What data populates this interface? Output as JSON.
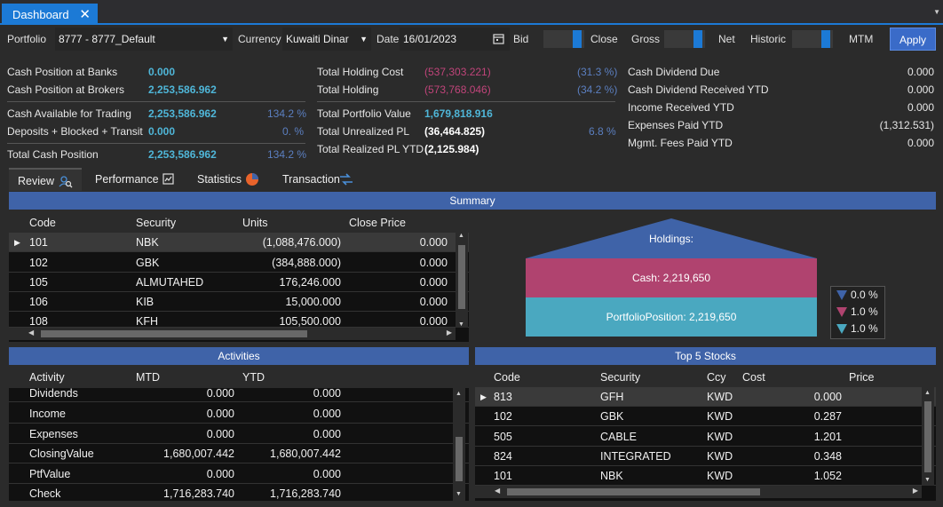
{
  "tab": {
    "title": "Dashboard",
    "close": "✕"
  },
  "toolbar": {
    "portfolio_label": "Portfolio",
    "portfolio_value": "8777 - 8777_Default",
    "currency_label": "Currency",
    "currency_value": "Kuwaiti Dinar",
    "date_label": "Date",
    "date_value": "16/01/2023",
    "bid": "Bid",
    "close": "Close",
    "gross": "Gross",
    "net": "Net",
    "historic": "Historic",
    "mtm": "MTM",
    "apply": "Apply"
  },
  "stats": {
    "cash_banks_label": "Cash Position at Banks",
    "cash_banks": "0.000",
    "cash_brokers_label": "Cash Position at Brokers",
    "cash_brokers": "2,253,586.962",
    "cash_avail_label": "Cash Available for Trading",
    "cash_avail": "2,253,586.962",
    "cash_avail_pct": "134.2 %",
    "deposits_label": "Deposits + Blocked + Transit",
    "deposits": "0.000",
    "deposits_pct": "0. %",
    "total_cash_label": "Total Cash Position",
    "total_cash": "2,253,586.962",
    "total_cash_pct": "134.2 %",
    "hold_cost_label": "Total Holding Cost",
    "hold_cost": "(537,303.221)",
    "hold_cost_pct": "(31.3 %)",
    "holding_label": "Total Holding",
    "holding": "(573,768.046)",
    "holding_pct": "(34.2 %)",
    "port_val_label": "Total Portfolio Value",
    "port_val": "1,679,818.916",
    "unreal_label": "Total Unrealized PL",
    "unreal": "(36,464.825)",
    "unreal_pct": "6.8 %",
    "real_label": "Total Realized PL YTD",
    "real": "(2,125.984)",
    "div_due_label": "Cash Dividend Due",
    "div_due": "0.000",
    "div_recv_label": "Cash Dividend Received YTD",
    "div_recv": "0.000",
    "income_label": "Income Received YTD",
    "income": "0.000",
    "expenses_label": "Expenses Paid YTD",
    "expenses": "(1,312.531)",
    "fees_label": "Mgmt. Fees Paid YTD",
    "fees": "0.000"
  },
  "view_tabs": [
    "Review",
    "Performance",
    "Statistics",
    "Transaction"
  ],
  "summary": {
    "title": "Summary",
    "headers": [
      "Code",
      "Security",
      "Units",
      "Close Price"
    ],
    "rows": [
      [
        "101",
        "NBK",
        "(1,088,476.000)",
        "0.000"
      ],
      [
        "102",
        "GBK",
        "(384,888.000)",
        "0.000"
      ],
      [
        "105",
        "ALMUTAHED",
        "176,246.000",
        "0.000"
      ],
      [
        "106",
        "KIB",
        "15,000.000",
        "0.000"
      ],
      [
        "108",
        "KFH",
        "105,500.000",
        "0.000"
      ]
    ]
  },
  "chart_data": {
    "type": "funnel",
    "title": "Holdings:",
    "segments": [
      {
        "label": "Cash: 2,219,650",
        "value": 2219650,
        "color": "#b0436f"
      },
      {
        "label": "PortfolioPosition: 2,219,650",
        "value": 2219650,
        "color": "#4aa8c0"
      }
    ],
    "legend": [
      "0.0 %",
      "1.0 %",
      "1.0 %"
    ],
    "legend_colors": [
      "#3f63a8",
      "#b0436f",
      "#4aa8c0"
    ]
  },
  "activities": {
    "title": "Activities",
    "headers": [
      "Activity",
      "MTD",
      "YTD"
    ],
    "rows": [
      [
        "Dividends",
        "0.000",
        "0.000"
      ],
      [
        "Income",
        "0.000",
        "0.000"
      ],
      [
        "Expenses",
        "0.000",
        "0.000"
      ],
      [
        "ClosingValue",
        "1,680,007.442",
        "1,680,007.442"
      ],
      [
        "PtfValue",
        "0.000",
        "0.000"
      ],
      [
        "Check",
        "1,716,283.740",
        "1,716,283.740"
      ]
    ]
  },
  "top5": {
    "title": "Top 5 Stocks",
    "headers": [
      "Code",
      "Security",
      "Ccy",
      "Cost",
      "Price"
    ],
    "rows": [
      [
        "813",
        "GFH",
        "KWD",
        "0.000"
      ],
      [
        "102",
        "GBK",
        "KWD",
        "0.287"
      ],
      [
        "505",
        "CABLE",
        "KWD",
        "1.201"
      ],
      [
        "824",
        "INTEGRATED",
        "KWD",
        "0.348"
      ],
      [
        "101",
        "NBK",
        "KWD",
        "1.052"
      ]
    ]
  }
}
